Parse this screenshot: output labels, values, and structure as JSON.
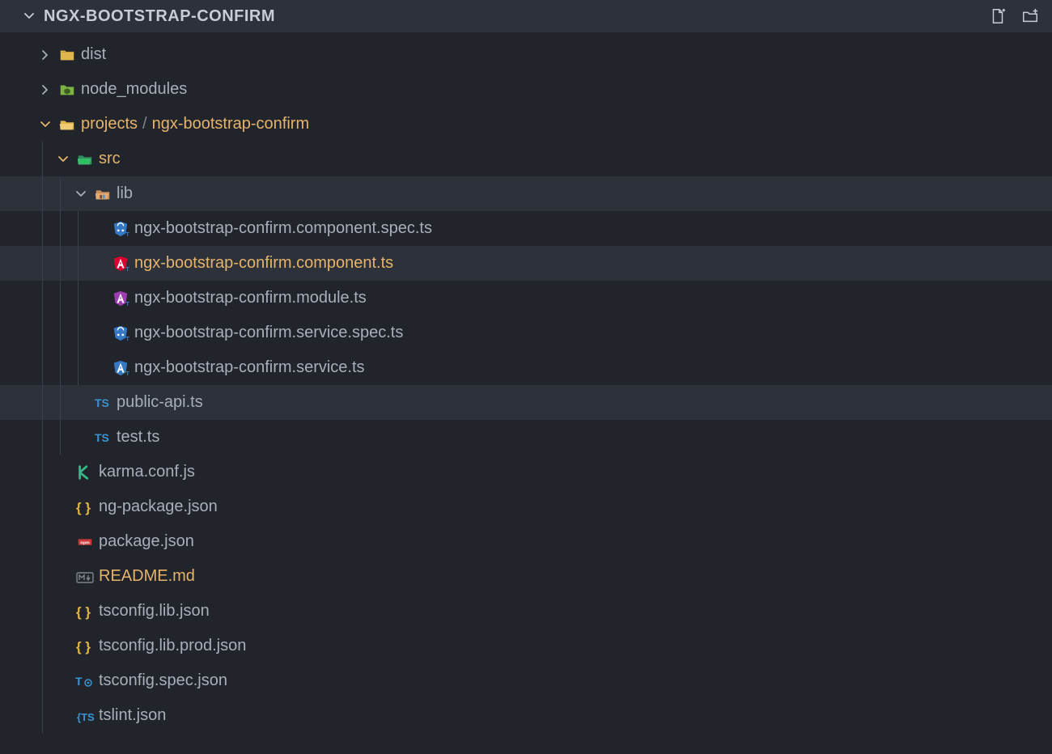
{
  "header": {
    "title": "NGX-BOOTSTRAP-CONFIRM"
  },
  "tree": [
    {
      "depth": 0,
      "kind": "folder",
      "expanded": false,
      "icon": "folder-yellow",
      "label": "dist"
    },
    {
      "depth": 0,
      "kind": "folder",
      "expanded": false,
      "icon": "folder-node",
      "label": "node_modules"
    },
    {
      "depth": 0,
      "kind": "folder",
      "expanded": true,
      "icon": "folder-open",
      "label": "projects / ngx-bootstrap-confirm",
      "highlight": "accent"
    },
    {
      "depth": 1,
      "kind": "folder",
      "expanded": true,
      "icon": "folder-src",
      "label": "src",
      "highlight": "accent"
    },
    {
      "depth": 2,
      "kind": "folder",
      "expanded": true,
      "icon": "folder-lib",
      "label": "lib",
      "bg": "dim"
    },
    {
      "depth": 3,
      "kind": "file",
      "icon": "ng-spec",
      "label": "ngx-bootstrap-confirm.component.spec.ts"
    },
    {
      "depth": 3,
      "kind": "file",
      "icon": "ng-red",
      "label": "ngx-bootstrap-confirm.component.ts",
      "highlight": "accent",
      "bg": "sel"
    },
    {
      "depth": 3,
      "kind": "file",
      "icon": "ng-purple",
      "label": "ngx-bootstrap-confirm.module.ts"
    },
    {
      "depth": 3,
      "kind": "file",
      "icon": "ng-spec",
      "label": "ngx-bootstrap-confirm.service.spec.ts"
    },
    {
      "depth": 3,
      "kind": "file",
      "icon": "ng-blue",
      "label": "ngx-bootstrap-confirm.service.ts"
    },
    {
      "depth": 2,
      "kind": "file",
      "icon": "ts",
      "label": "public-api.ts",
      "bg": "dim"
    },
    {
      "depth": 2,
      "kind": "file",
      "icon": "ts",
      "label": "test.ts"
    },
    {
      "depth": 1,
      "kind": "file",
      "icon": "karma",
      "label": "karma.conf.js"
    },
    {
      "depth": 1,
      "kind": "file",
      "icon": "json",
      "label": "ng-package.json"
    },
    {
      "depth": 1,
      "kind": "file",
      "icon": "npm",
      "label": "package.json"
    },
    {
      "depth": 1,
      "kind": "file",
      "icon": "md",
      "label": "README.md",
      "highlight": "accent"
    },
    {
      "depth": 1,
      "kind": "file",
      "icon": "json",
      "label": "tsconfig.lib.json"
    },
    {
      "depth": 1,
      "kind": "file",
      "icon": "json",
      "label": "tsconfig.lib.prod.json"
    },
    {
      "depth": 1,
      "kind": "file",
      "icon": "ts-cog",
      "label": "tsconfig.spec.json"
    },
    {
      "depth": 1,
      "kind": "file",
      "icon": "tslint",
      "label": "tslint.json"
    }
  ]
}
